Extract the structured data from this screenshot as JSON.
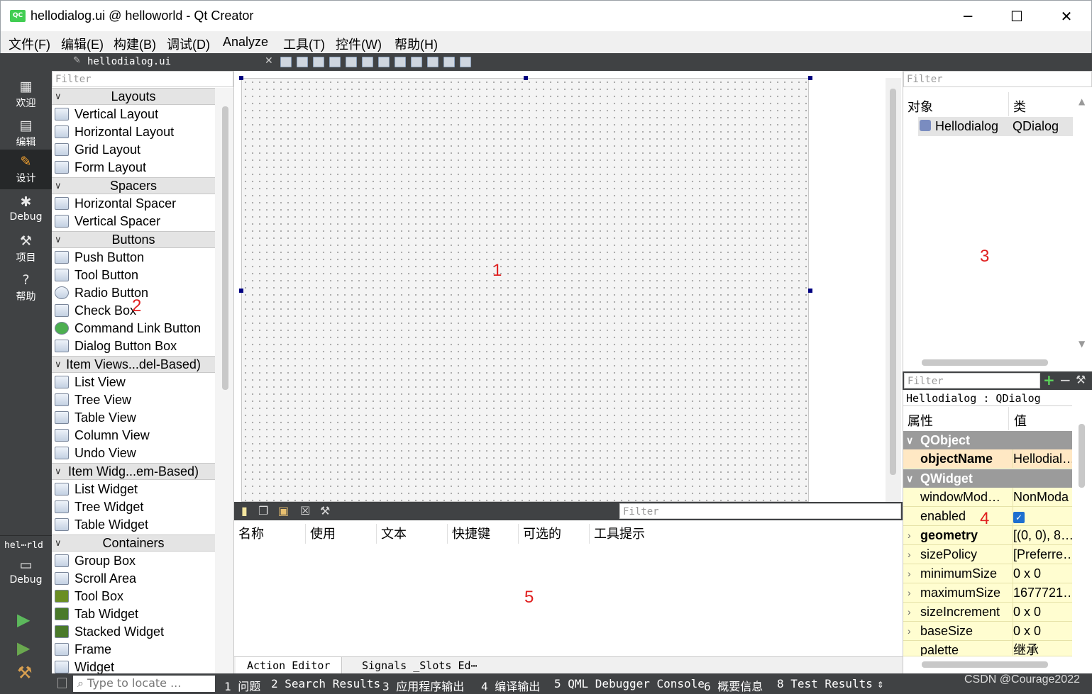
{
  "window": {
    "app_icon": "QC",
    "title": "hellodialog.ui @ helloworld - Qt Creator",
    "minimize": "─",
    "maximize": "☐",
    "close": "✕"
  },
  "menu": [
    "文件(F)",
    "编辑(E)",
    "构建(B)",
    "调试(D)",
    "Analyze",
    "工具(T)",
    "控件(W)",
    "帮助(H)"
  ],
  "modes": [
    {
      "label": "欢迎",
      "icon": "grid-icon"
    },
    {
      "label": "编辑",
      "icon": "document-icon"
    },
    {
      "label": "设计",
      "icon": "pencil-icon"
    },
    {
      "label": "Debug",
      "icon": "bug-icon"
    },
    {
      "label": "项目",
      "icon": "wrench-icon"
    },
    {
      "label": "帮助",
      "icon": "help-icon"
    }
  ],
  "kit": {
    "project": "hel⋯rld",
    "config": "Debug"
  },
  "editor": {
    "file_tab": "hellodialog.ui",
    "close": "✕"
  },
  "widget_box": {
    "filter_placeholder": "Filter",
    "categories": [
      {
        "name": "Layouts",
        "items": [
          "Vertical Layout",
          "Horizontal Layout",
          "Grid Layout",
          "Form Layout"
        ]
      },
      {
        "name": "Spacers",
        "items": [
          "Horizontal Spacer",
          "Vertical Spacer"
        ]
      },
      {
        "name": "Buttons",
        "items": [
          "Push Button",
          "Tool Button",
          "Radio Button",
          "Check Box",
          "Command Link Button",
          "Dialog Button Box"
        ]
      },
      {
        "name": "Item Views...del-Based)",
        "items": [
          "List View",
          "Tree View",
          "Table View",
          "Column View",
          "Undo View"
        ]
      },
      {
        "name": "Item Widg...em-Based)",
        "items": [
          "List Widget",
          "Tree Widget",
          "Table Widget"
        ]
      },
      {
        "name": "Containers",
        "items": [
          "Group Box",
          "Scroll Area",
          "Tool Box",
          "Tab Widget",
          "Stacked Widget",
          "Frame",
          "Widget"
        ]
      }
    ]
  },
  "annotations": [
    "1",
    "2",
    "3",
    "4",
    "5"
  ],
  "action_editor": {
    "filter_placeholder": "Filter",
    "columns": [
      "名称",
      "使用",
      "文本",
      "快捷键",
      "可选的",
      "工具提示"
    ],
    "tabs": [
      "Action Editor",
      "Signals _Slots Ed⋯"
    ]
  },
  "object_inspector": {
    "filter_placeholder": "Filter",
    "columns": [
      "对象",
      "类"
    ],
    "rows": [
      {
        "object": "Hellodialog",
        "class": "QDialog"
      }
    ]
  },
  "property_editor": {
    "filter_placeholder": "Filter",
    "object_label": "Hellodialog : QDialog",
    "columns": [
      "属性",
      "值"
    ],
    "groups": [
      "QObject",
      "QWidget"
    ],
    "rows": [
      {
        "name": "objectName",
        "value": "Hellodial…",
        "bold": true
      },
      {
        "name": "windowMod…",
        "value": "NonModa"
      },
      {
        "name": "enabled",
        "value": "true"
      },
      {
        "name": "geometry",
        "value": "[(0, 0), 8…",
        "bold": true
      },
      {
        "name": "sizePolicy",
        "value": "[Preferre…"
      },
      {
        "name": "minimumSize",
        "value": "0 x 0"
      },
      {
        "name": "maximumSize",
        "value": "1677721…"
      },
      {
        "name": "sizeIncrement",
        "value": "0 x 0"
      },
      {
        "name": "baseSize",
        "value": "0 x 0"
      },
      {
        "name": "palette",
        "value": "继承"
      }
    ]
  },
  "status_bar": {
    "locate_placeholder": "Type to locate ...",
    "items": [
      "1 问题",
      "2 Search Results",
      "3 应用程序输出",
      "4 编译输出",
      "5 QML Debugger Console",
      "6 概要信息",
      "8 Test Results"
    ],
    "watermark": "CSDN @Courage2022"
  },
  "colors": {
    "sidebar": "#404244",
    "property_row": "#fffdd0",
    "annotation": "#e02020",
    "selection_handle": "#000080"
  }
}
